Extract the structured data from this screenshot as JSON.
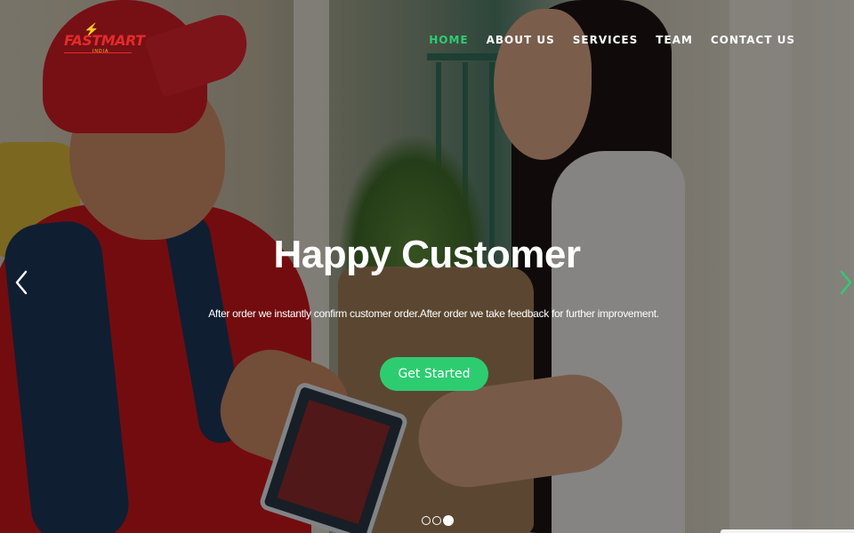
{
  "brand": {
    "name": "FASTMART",
    "tagline": "INDIA",
    "colors": {
      "primary": "#e32b2b",
      "accent": "#f6c21c"
    }
  },
  "nav": {
    "items": [
      {
        "label": "HOME",
        "active": true
      },
      {
        "label": "ABOUT US",
        "active": false
      },
      {
        "label": "SERVICES",
        "active": false
      },
      {
        "label": "TEAM",
        "active": false
      },
      {
        "label": "CONTACT US",
        "active": false
      }
    ],
    "active_color": "#2ecc71"
  },
  "hero": {
    "title": "Happy Customer",
    "subtitle": "After order we instantly confirm customer order.After order we take feedback for further improvement.",
    "cta_label": "Get Started",
    "cta_color": "#2ecc71",
    "background_image": "delivery-man-handing-groceries-to-woman",
    "prev_icon": "chevron-left-icon",
    "next_icon": "chevron-right-icon"
  },
  "carousel": {
    "slides": 3,
    "active_index": 2
  }
}
